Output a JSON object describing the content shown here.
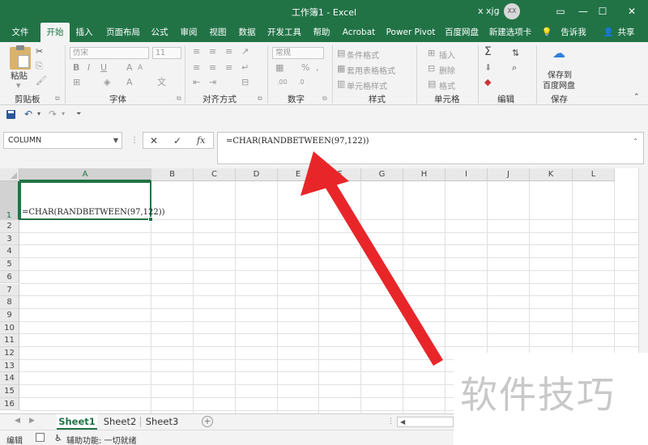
{
  "titlebar": {
    "title": "工作簿1  -  Excel",
    "user": "x xjg",
    "avatar_initials": "XX",
    "minimize_glyph": "—",
    "restore_glyph": "☐",
    "close_glyph": "✕",
    "ribbon_display_glyph": "▭"
  },
  "tabs": [
    {
      "label": "文件"
    },
    {
      "label": "开始"
    },
    {
      "label": "插入"
    },
    {
      "label": "页面布局"
    },
    {
      "label": "公式"
    },
    {
      "label": "审阅"
    },
    {
      "label": "视图"
    },
    {
      "label": "数据"
    },
    {
      "label": "开发工具"
    },
    {
      "label": "帮助"
    },
    {
      "label": "Acrobat"
    },
    {
      "label": "Power Pivot"
    },
    {
      "label": "百度网盘"
    },
    {
      "label": "新建选项卡"
    },
    {
      "label": "告诉我"
    },
    {
      "label": "共享"
    }
  ],
  "ribbon": {
    "clipboard": {
      "paste": "粘贴",
      "group": "剪贴板"
    },
    "font": {
      "font_name": "仿宋",
      "font_size": "11",
      "group": "字体"
    },
    "alignment": {
      "group": "对齐方式"
    },
    "number": {
      "format": "常规",
      "group": "数字"
    },
    "styles": {
      "conditional": "条件格式",
      "table": "套用表格格式",
      "cell": "单元格样式",
      "group": "样式"
    },
    "cells": {
      "insert": "插入",
      "delete": "删除",
      "format": "格式",
      "group": "单元格"
    },
    "editing": {
      "group": "编辑"
    },
    "save": {
      "line1": "保存到",
      "line2": "百度网盘",
      "group": "保存"
    }
  },
  "formula_bar": {
    "name_box": "COLUMN",
    "formula": "=CHAR(RANDBETWEEN(97,122))"
  },
  "grid": {
    "columns": [
      "A",
      "B",
      "C",
      "D",
      "E",
      "F",
      "G",
      "H",
      "I",
      "J",
      "K",
      "L"
    ],
    "rows": [
      "1",
      "2",
      "3",
      "4",
      "5",
      "6",
      "7",
      "8",
      "9",
      "10",
      "11",
      "12",
      "13",
      "14",
      "15",
      "16"
    ],
    "active_cell_text": "=CHAR(RANDBETWEEN(97,122))"
  },
  "sheets": [
    {
      "label": "Sheet1",
      "active": true
    },
    {
      "label": "Sheet2",
      "active": false
    },
    {
      "label": "Sheet3",
      "active": false
    }
  ],
  "status": {
    "mode": "编辑",
    "accessibility": "辅助功能: 一切就绪"
  },
  "watermark": "软件技巧",
  "colors": {
    "excel_green": "#217346",
    "arrow_red": "#e8262a"
  }
}
